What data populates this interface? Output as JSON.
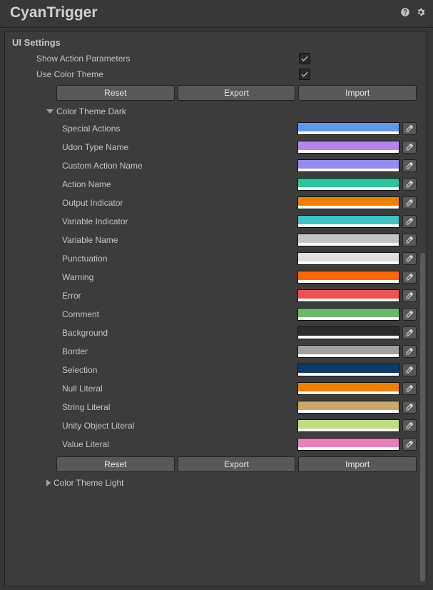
{
  "header": {
    "title": "CyanTrigger"
  },
  "section": {
    "title": "UI Settings",
    "showActionParams": {
      "label": "Show Action Parameters",
      "checked": true
    },
    "useColorTheme": {
      "label": "Use Color Theme",
      "checked": true
    },
    "buttons": {
      "reset": "Reset",
      "export": "Export",
      "import": "Import"
    },
    "darkFoldout": "Color Theme Dark",
    "lightFoldout": "Color Theme Light",
    "colors": [
      {
        "label": "Special Actions",
        "hex": "#6495ED"
      },
      {
        "label": "Udon Type Name",
        "hex": "#B884F0"
      },
      {
        "label": "Custom Action Name",
        "hex": "#948AF2"
      },
      {
        "label": "Action Name",
        "hex": "#2BC59A"
      },
      {
        "label": "Output Indicator",
        "hex": "#F08000"
      },
      {
        "label": "Variable Indicator",
        "hex": "#3DC4C4"
      },
      {
        "label": "Variable Name",
        "hex": "#C4C4C4"
      },
      {
        "label": "Punctuation",
        "hex": "#E0E0E0"
      },
      {
        "label": "Warning",
        "hex": "#FF6600"
      },
      {
        "label": "Error",
        "hex": "#F05050"
      },
      {
        "label": "Comment",
        "hex": "#6CB86C"
      },
      {
        "label": "Background",
        "hex": "#2B2B2B"
      },
      {
        "label": "Border",
        "hex": "#A0A0A0"
      },
      {
        "label": "Selection",
        "hex": "#0D3A66"
      },
      {
        "label": "Null Literal",
        "hex": "#F08000"
      },
      {
        "label": "String Literal",
        "hex": "#C9A86A"
      },
      {
        "label": "Unity Object Literal",
        "hex": "#C1DC7F"
      },
      {
        "label": "Value Literal",
        "hex": "#EA7FB9"
      }
    ]
  }
}
